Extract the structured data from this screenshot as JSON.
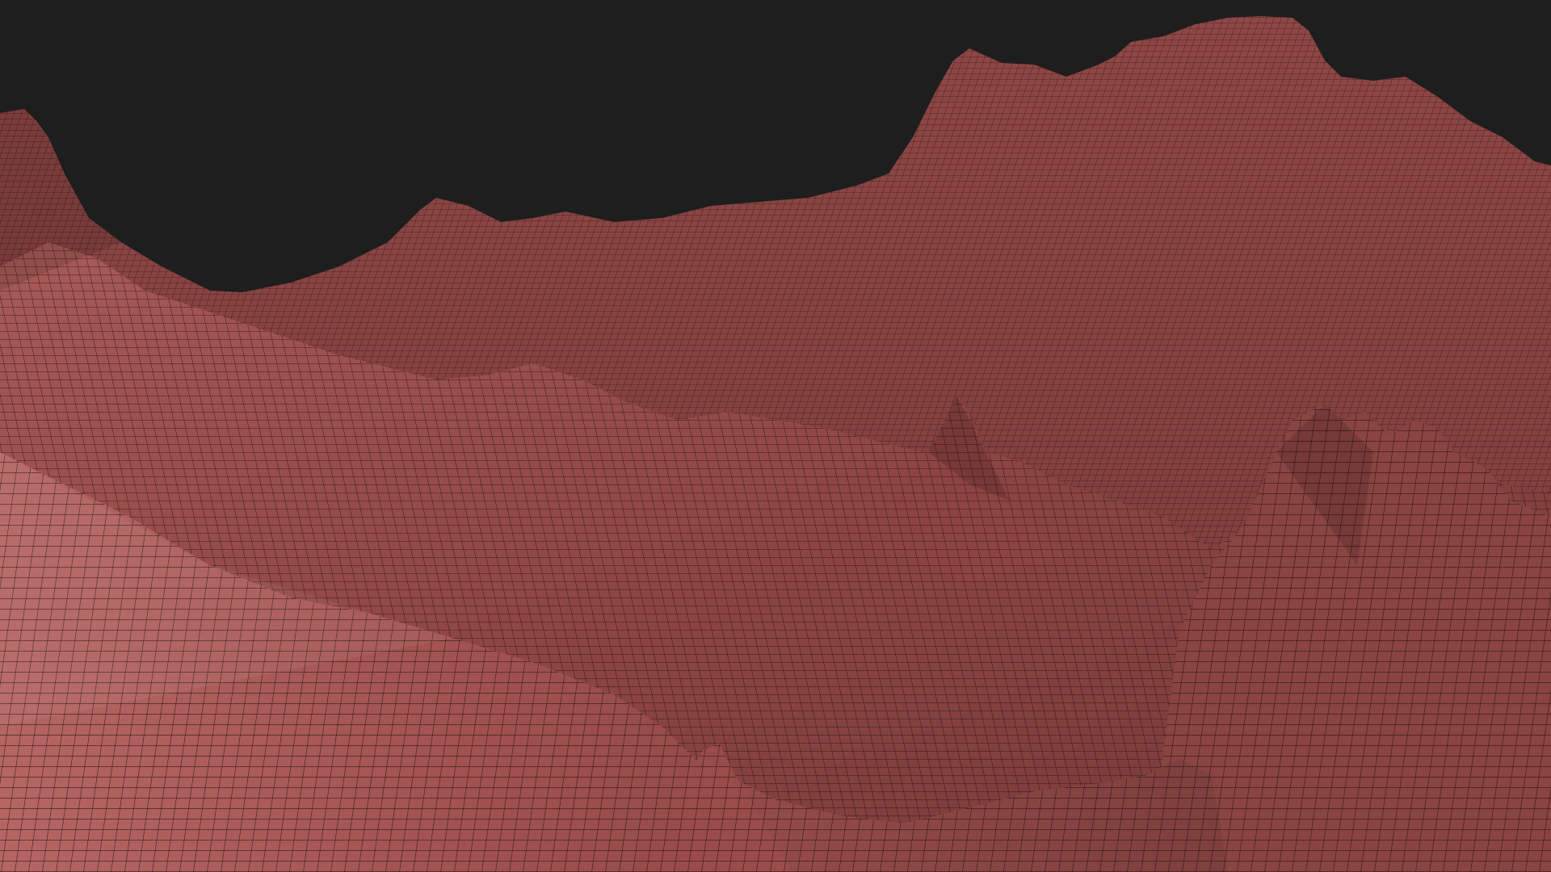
{
  "scene": {
    "subject": "wireframe-terrain",
    "colors": {
      "background": "#1e1e1e",
      "terrain_fill": "#9a4e4c",
      "terrain_light": "#b26360",
      "terrain_dark": "#6e3534",
      "wire": "#1a0d0d"
    }
  }
}
